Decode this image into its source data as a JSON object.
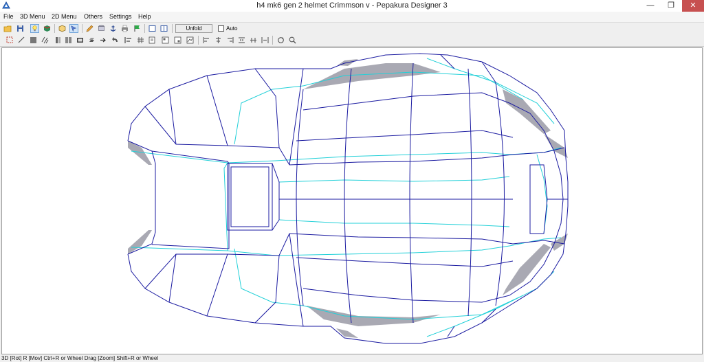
{
  "window": {
    "title": "h4 mk6 gen 2 helmet  Crimmson v - Pepakura Designer 3",
    "app_icon": "pepakura-icon",
    "controls": {
      "minimize": "—",
      "restore": "❐",
      "close": "✕"
    },
    "close_color": "#c75050"
  },
  "menu": [
    "File",
    "3D Menu",
    "2D Menu",
    "Others",
    "Settings",
    "Help"
  ],
  "toolbar": {
    "unfold_label": "Unfold",
    "auto_label": "Auto",
    "auto_checked": false,
    "row1_icons": [
      "open-icon",
      "save-icon",
      "lightbulb-icon",
      "texture-icon",
      "box-icon",
      "select-icon",
      "pencil-icon",
      "cylinder-icon",
      "anchor-icon",
      "print-icon",
      "flag-icon",
      "single-view-icon",
      "dual-view-icon"
    ],
    "row2_icons": [
      "select-face-icon",
      "edge-icon",
      "fill-icon",
      "hatch-icon",
      "join-icon",
      "split-icon",
      "move-icon",
      "rotate-icon",
      "flip-icon",
      "undo-icon",
      "align-icon",
      "grid-icon",
      "page-icon",
      "layout-icon",
      "align-left-icon",
      "align-center-icon",
      "align-right-icon",
      "distribute-icon",
      "stack-icon",
      "spread-icon",
      "refresh-icon",
      "zoom-fit-icon"
    ]
  },
  "viewport": {
    "mode": "3D",
    "model": "helmet wireframe",
    "colors": {
      "fold_edge": "#1a1aa0",
      "seam_edge": "#22d0d8",
      "shaded_face": "#a8a8b0",
      "face": "#ffffff"
    }
  },
  "status": {
    "text": "3D [Rot] R [Mov] Ctrl+R or Wheel Drag [Zoom] Shift+R or Wheel"
  }
}
